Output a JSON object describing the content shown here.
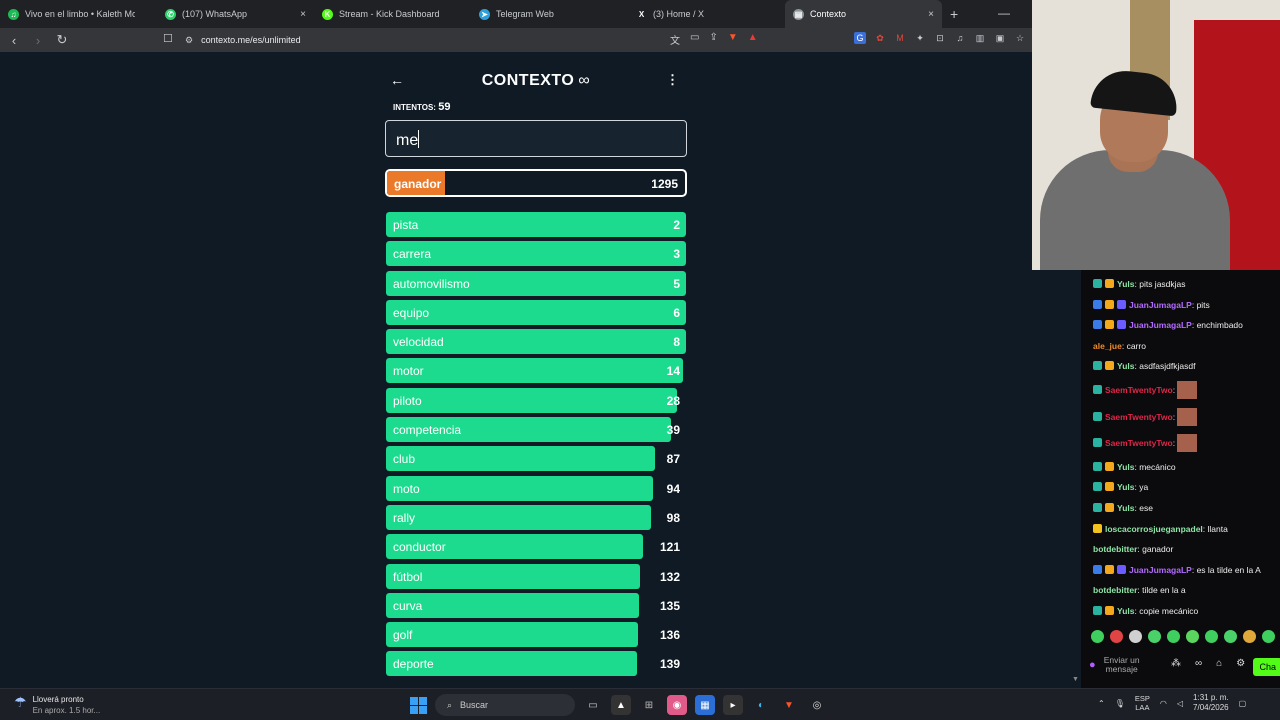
{
  "browser": {
    "tabs": [
      {
        "title": "Vivo en el limbo • Kaleth Morale",
        "icon": "spotify-icon",
        "color": "#1db954",
        "glyph": "♫"
      },
      {
        "title": "(107) WhatsApp",
        "icon": "whatsapp-icon",
        "color": "#25d366",
        "glyph": "✆"
      },
      {
        "title": "Stream - Kick Dashboard",
        "icon": "kick-icon",
        "color": "#53fc18",
        "glyph": "K"
      },
      {
        "title": "Telegram Web",
        "icon": "telegram-icon",
        "color": "#2aa1de",
        "glyph": "➤"
      },
      {
        "title": "(3) Home / X",
        "icon": "x-icon",
        "color": "#202124",
        "glyph": "X"
      },
      {
        "title": "Contexto",
        "icon": "page-icon",
        "color": "#8d949a",
        "glyph": "▤"
      }
    ],
    "new_tab": "+",
    "url": "contexto.me/es/unlimited"
  },
  "game": {
    "title": "CONTEXTO",
    "title_symbol": "∞",
    "tries_label": "INTENTOS:",
    "tries_value": "59",
    "input_value": "me",
    "winner": {
      "word": "ganador",
      "rank": "1295"
    },
    "guesses": [
      {
        "word": "pista",
        "rank": "2",
        "fill": 1.0
      },
      {
        "word": "carrera",
        "rank": "3",
        "fill": 1.0
      },
      {
        "word": "automovilismo",
        "rank": "5",
        "fill": 1.0
      },
      {
        "word": "equipo",
        "rank": "6",
        "fill": 1.0
      },
      {
        "word": "velocidad",
        "rank": "8",
        "fill": 1.0
      },
      {
        "word": "motor",
        "rank": "14",
        "fill": 0.99
      },
      {
        "word": "piloto",
        "rank": "28",
        "fill": 0.97
      },
      {
        "word": "competencia",
        "rank": "39",
        "fill": 0.95
      },
      {
        "word": "club",
        "rank": "87",
        "fill": 0.897
      },
      {
        "word": "moto",
        "rank": "94",
        "fill": 0.89
      },
      {
        "word": "rally",
        "rank": "98",
        "fill": 0.883
      },
      {
        "word": "conductor",
        "rank": "121",
        "fill": 0.857
      },
      {
        "word": "fútbol",
        "rank": "132",
        "fill": 0.847
      },
      {
        "word": "curva",
        "rank": "135",
        "fill": 0.843
      },
      {
        "word": "golf",
        "rank": "136",
        "fill": 0.84
      },
      {
        "word": "deporte",
        "rank": "139",
        "fill": 0.837
      }
    ]
  },
  "chat": {
    "messages": [
      {
        "user": "Yuls",
        "text": "pits jasdkjas",
        "color": "#8fe3a6",
        "badges": [
          "#2ab3a0",
          "#f4a91d"
        ]
      },
      {
        "user": "JuanJumagaLP",
        "text": "pits",
        "color": "#b36bff",
        "badges": [
          "#3b7de8",
          "#f4a91d",
          "#6a5cff"
        ]
      },
      {
        "user": "JuanJumagaLP",
        "text": "enchimbado",
        "color": "#b36bff",
        "badges": [
          "#3b7de8",
          "#f4a91d",
          "#6a5cff"
        ]
      },
      {
        "user": "ale_jue",
        "text": "carro",
        "color": "#f28c28",
        "badges": []
      },
      {
        "user": "Yuls",
        "text": "asdfasjdfkjasdf",
        "color": "#8fe3a6",
        "badges": [
          "#2ab3a0",
          "#f4a91d"
        ]
      },
      {
        "user": "SaemTwentyTwo",
        "text": "",
        "color": "#e0264a",
        "badges": [
          "#2ab3a0"
        ],
        "emote": true
      },
      {
        "user": "SaemTwentyTwo",
        "text": "",
        "color": "#e0264a",
        "badges": [
          "#2ab3a0"
        ],
        "emote": true
      },
      {
        "user": "SaemTwentyTwo",
        "text": "",
        "color": "#e0264a",
        "badges": [
          "#2ab3a0"
        ],
        "emote": true
      },
      {
        "user": "Yuls",
        "text": "mecánico",
        "color": "#8fe3a6",
        "badges": [
          "#2ab3a0",
          "#f4a91d"
        ]
      },
      {
        "user": "Yuls",
        "text": "ya",
        "color": "#8fe3a6",
        "badges": [
          "#2ab3a0",
          "#f4a91d"
        ]
      },
      {
        "user": "Yuls",
        "text": "ese",
        "color": "#8fe3a6",
        "badges": [
          "#2ab3a0",
          "#f4a91d"
        ]
      },
      {
        "user": "loscacorrosjueganpadel",
        "text": "llanta",
        "color": "#8fe3a6",
        "badges": [
          "#f4c21d"
        ]
      },
      {
        "user": "botdebitter",
        "text": "ganador",
        "color": "#8fe3a6",
        "badges": []
      },
      {
        "user": "JuanJumagaLP",
        "text": "es la tilde en la A",
        "color": "#b36bff",
        "badges": [
          "#3b7de8",
          "#f4a91d",
          "#6a5cff"
        ]
      },
      {
        "user": "botdebitter",
        "text": "tilde en la a",
        "color": "#8fe3a6",
        "badges": []
      },
      {
        "user": "Yuls",
        "text": "copie mecánico",
        "color": "#8fe3a6",
        "badges": [
          "#2ab3a0",
          "#f4a91d"
        ]
      }
    ],
    "send_placeholder": "Enviar un mensaje",
    "chat_button": "Cha"
  },
  "taskbar": {
    "weather_title": "Lloverá pronto",
    "weather_sub": "En aprox. 1.5 hor...",
    "search_label": "Buscar",
    "lang_top": "ESP",
    "lang_bottom": "LAA",
    "time": "1:31 p. m.",
    "date": "7/04/2026"
  }
}
